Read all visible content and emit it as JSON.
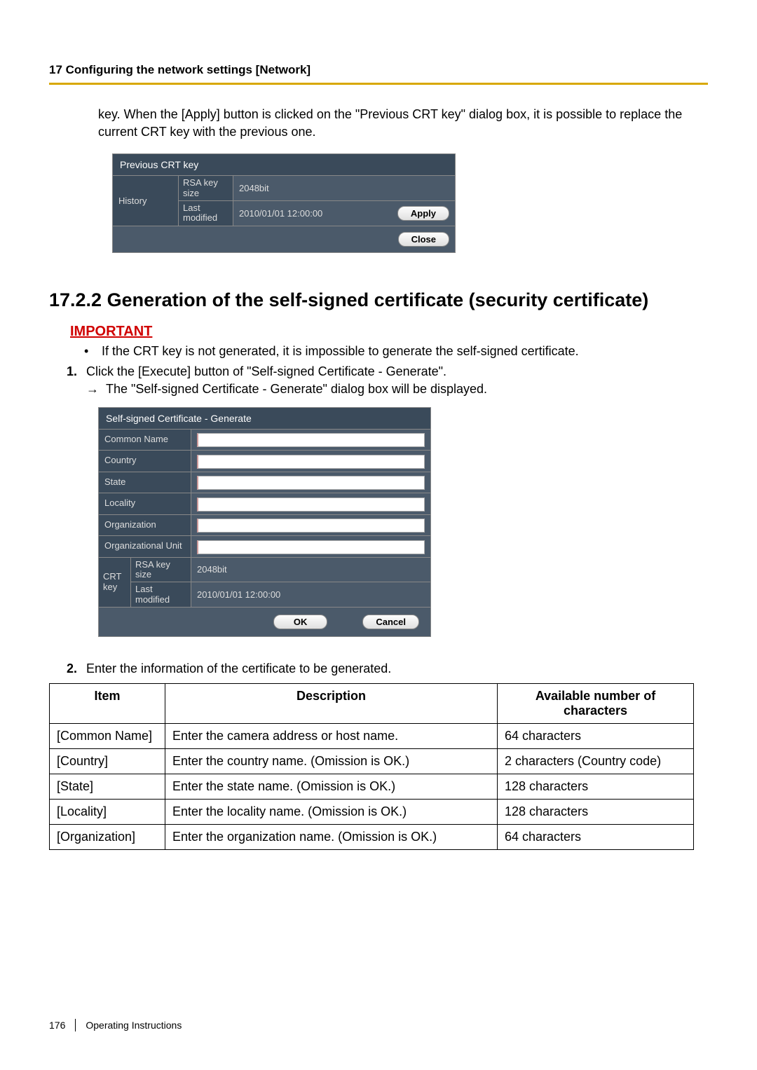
{
  "header": "17 Configuring the network settings [Network]",
  "intro": "key. When the [Apply] button is clicked on the \"Previous CRT key\" dialog box, it is possible to replace the current CRT key with the previous one.",
  "prev_dialog": {
    "title": "Previous CRT key",
    "history_label": "History",
    "rsa_label": "RSA key size",
    "rsa_value": "2048bit",
    "last_label": "Last modified",
    "last_value": "2010/01/01 12:00:00",
    "apply_btn": "Apply",
    "close_btn": "Close"
  },
  "section_heading": "17.2.2  Generation of the self-signed certificate (security certificate)",
  "important_label": "IMPORTANT",
  "important_bullet": "If the CRT key is not generated, it is impossible to generate the self-signed certificate.",
  "step1_num": "1.",
  "step1_text": "Click the [Execute] button of \"Self-signed Certificate - Generate\".",
  "step1_arrow_text": "The \"Self-signed Certificate - Generate\" dialog box will be displayed.",
  "cert_dialog": {
    "title": "Self-signed Certificate - Generate",
    "fields": {
      "common_name": "Common Name",
      "country": "Country",
      "state": "State",
      "locality": "Locality",
      "organization": "Organization",
      "org_unit": "Organizational Unit"
    },
    "crt_label": "CRT key",
    "rsa_label": "RSA key size",
    "rsa_value": "2048bit",
    "last_label": "Last modified",
    "last_value": "2010/01/01 12:00:00",
    "ok_btn": "OK",
    "cancel_btn": "Cancel"
  },
  "step2_num": "2.",
  "step2_text": "Enter the information of the certificate to be generated.",
  "spec_table": {
    "headers": [
      "Item",
      "Description",
      "Available number of characters"
    ],
    "rows": [
      [
        "[Common Name]",
        "Enter the camera address or host name.",
        "64 characters"
      ],
      [
        "[Country]",
        "Enter the country name. (Omission is OK.)",
        "2 characters (Country code)"
      ],
      [
        "[State]",
        "Enter the state name. (Omission is OK.)",
        "128 characters"
      ],
      [
        "[Locality]",
        "Enter the locality name. (Omission is OK.)",
        "128 characters"
      ],
      [
        "[Organization]",
        "Enter the organization name. (Omission is OK.)",
        "64 characters"
      ]
    ]
  },
  "footer": {
    "page": "176",
    "label": "Operating Instructions"
  }
}
